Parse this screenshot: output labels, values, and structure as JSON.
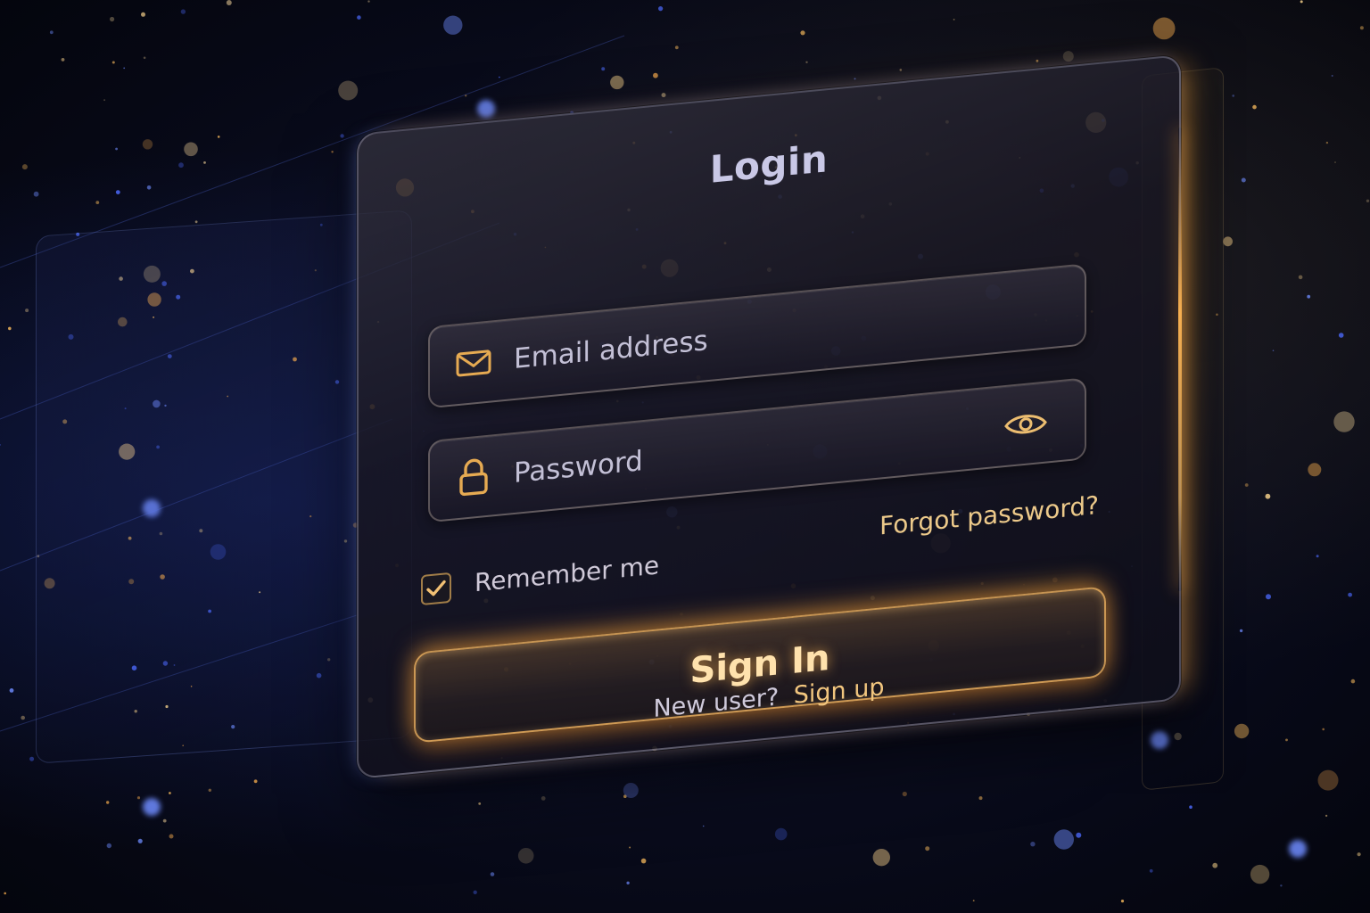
{
  "login_card": {
    "title": "Login",
    "email_field": {
      "placeholder": "Email address",
      "icon": "envelope-icon"
    },
    "password_field": {
      "placeholder": "Password",
      "icon": "lock-icon",
      "toggle_icon": "eye-icon"
    },
    "remember_me": {
      "label": "Remember me",
      "checked": true
    },
    "forgot_password_label": "Forgot password?",
    "sign_in_label": "Sign In",
    "footer": {
      "prompt": "New user?",
      "signup_label": "Sign up"
    }
  },
  "theme": {
    "accent": "#f0b45a",
    "text": "#c3c0d6",
    "background": "#07091a"
  }
}
